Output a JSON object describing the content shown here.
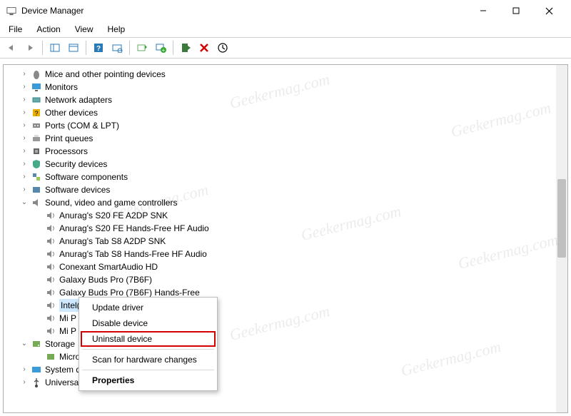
{
  "window": {
    "title": "Device Manager"
  },
  "menubar": {
    "file": "File",
    "action": "Action",
    "view": "View",
    "help": "Help"
  },
  "watermark": "Geekermag.com",
  "tree": {
    "mice": "Mice and other pointing devices",
    "monitors": "Monitors",
    "network": "Network adapters",
    "other": "Other devices",
    "ports": "Ports (COM & LPT)",
    "printq": "Print queues",
    "processors": "Processors",
    "security": "Security devices",
    "swcomp": "Software components",
    "swdev": "Software devices",
    "sound": "Sound, video and game controllers",
    "sound_children": {
      "c0": "Anurag's S20 FE A2DP SNK",
      "c1": "Anurag's S20 FE Hands-Free HF Audio",
      "c2": "Anurag's Tab S8 A2DP SNK",
      "c3": "Anurag's Tab S8 Hands-Free HF Audio",
      "c4": "Conexant SmartAudio HD",
      "c5": "Galaxy Buds Pro (7B6F)",
      "c6": "Galaxy Buds Pro (7B6F) Hands-Free",
      "c7": "Intel(R) Display Audio",
      "c8": "Mi P",
      "c9": "Mi P"
    },
    "storage": "Storage",
    "storage_children": {
      "s0": "Micro"
    },
    "system": "System d",
    "usb": "Universa"
  },
  "context_menu": {
    "update": "Update driver",
    "disable": "Disable device",
    "uninstall": "Uninstall device",
    "scan": "Scan for hardware changes",
    "properties": "Properties"
  }
}
